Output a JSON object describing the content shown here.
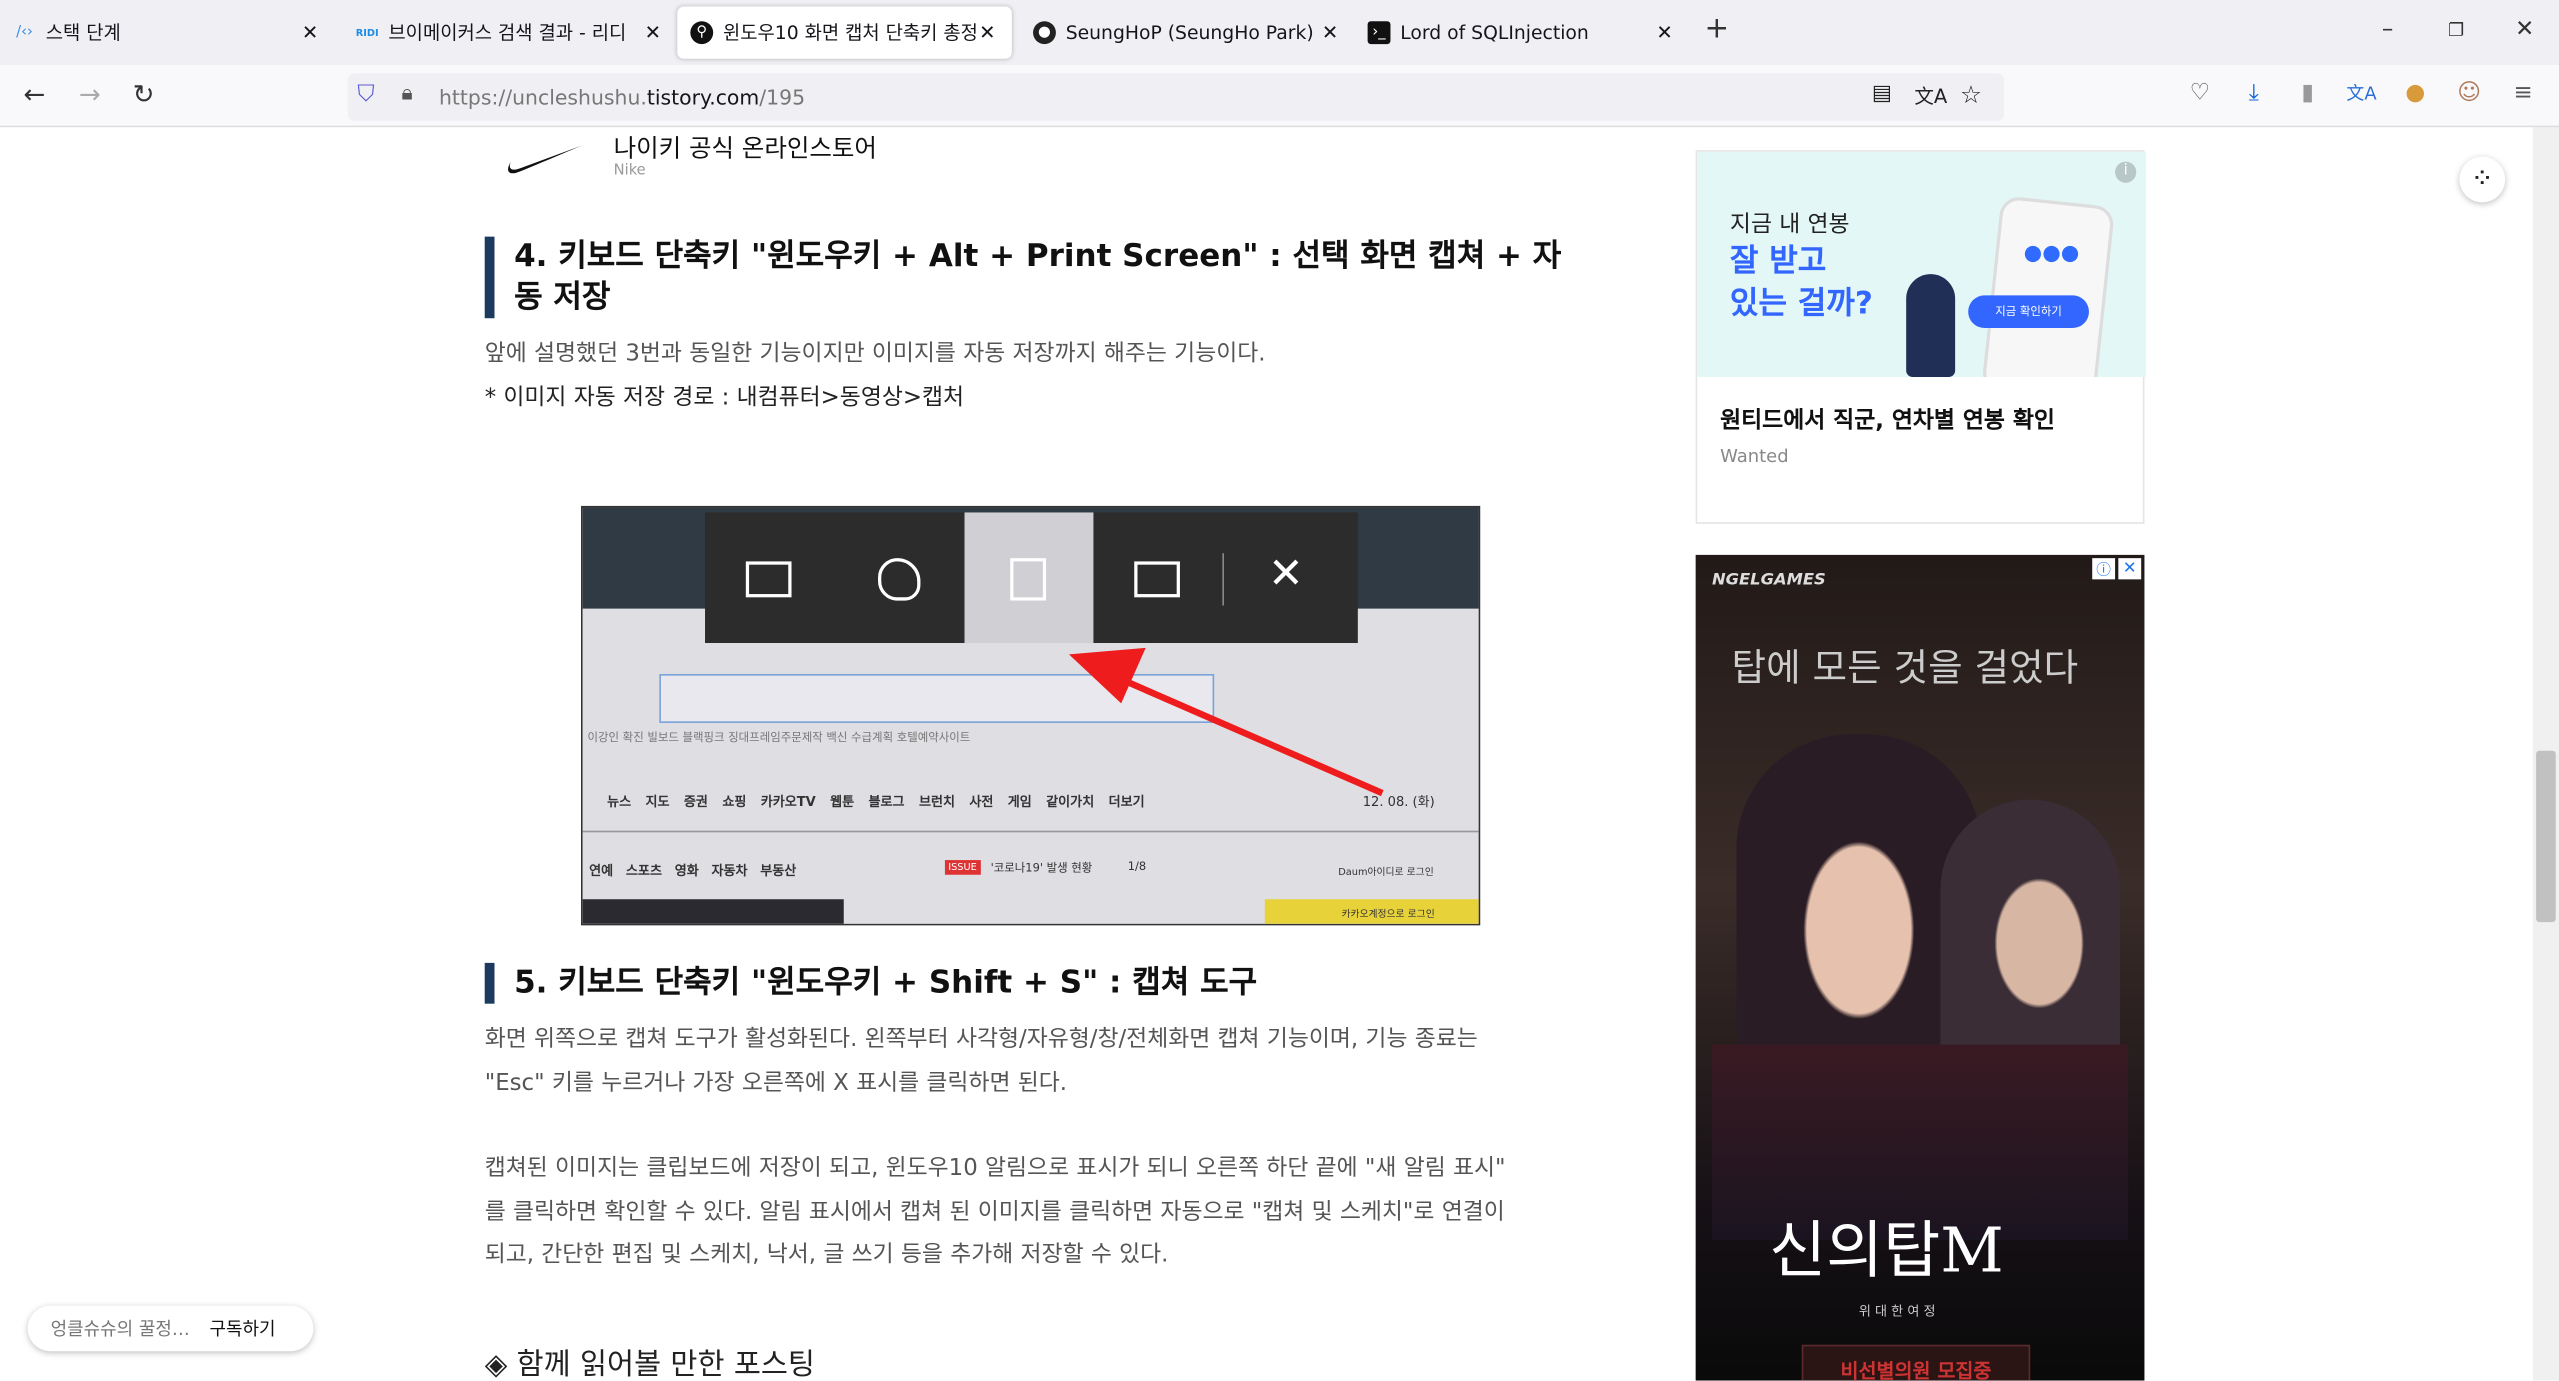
{
  "tabs": [
    {
      "title": "스택 단계",
      "icon": "code-brackets-icon",
      "active": false
    },
    {
      "title": "브이메이커스 검색 결과 - 리디",
      "icon": "ridi-icon",
      "active": false
    },
    {
      "title": "윈도우10 화면 캡처 단축키 총정리",
      "icon": "search-favicon",
      "active": true
    },
    {
      "title": "SeungHoP (SeungHo Park)",
      "icon": "github-icon",
      "active": false
    },
    {
      "title": "Lord of SQLInjection",
      "icon": "terminal-icon",
      "active": false
    }
  ],
  "url": {
    "prefix": "https://uncleshushu.",
    "domain": "tistory.com",
    "path": "/195"
  },
  "article": {
    "promo": {
      "title": "나이키 공식 온라인스토어",
      "brand": "Nike"
    },
    "h4": "4. 키보드 단축키 \"윈도우키 + Alt + Print Screen\" : 선택 화면 캡쳐 + 자동 저장",
    "p4a": "앞에 설명했던 3번과 동일한 기능이지만 이미지를 자동 저장까지 해주는 기능이다.",
    "p4b": "* 이미지 자동 저장 경로 : 내컴퓨터>동영상>캡처",
    "shot": {
      "menu": [
        "뉴스",
        "지도",
        "증권",
        "쇼핑",
        "카카오TV",
        "웹툰",
        "블로그",
        "브런치",
        "사전",
        "게임",
        "같이가치",
        "더보기"
      ],
      "date": "12. 08. (화)",
      "cats": [
        "연예",
        "스포츠",
        "영화",
        "자동차",
        "부동산"
      ],
      "issue": "ISSUE",
      "issue_text": "'코로나19' 발생 현황",
      "pager": "1/8",
      "login": "Daum아이디로 로그인",
      "kakao": "카카오계정으로 로그인",
      "trending": "이강인 확진   빌보드 블랙핑크   징대프레임주문제작   백신 수급계획   호텔예약사이트"
    },
    "h5": "5. 키보드 단축키 \"윈도우키 + Shift + S\" : 캡쳐 도구",
    "p5": [
      "화면 위쪽으로 캡쳐 도구가 활성화된다. 왼쪽부터 사각형/자유형/창/전체화면 캡쳐 기능이며, 기능 종료는",
      "\"Esc\" 키를 누르거나 가장 오른쪽에 X 표시를 클릭하면 된다."
    ],
    "p6": [
      "캡쳐된 이미지는 클립보드에 저장이 되고, 윈도우10 알림으로 표시가 되니 오른쪽 하단 끝에 \"새 알림 표시\"",
      "를 클릭하면 확인할 수 있다. 알림 표시에서 캡쳐 된 이미지를 클릭하면 자동으로 \"캡쳐 및 스케치\"로 연결이",
      "되고, 간단한 편집 및 스케치, 낙서, 글 쓰기 등을 추가해 저장할 수 있다."
    ],
    "related": "◈ 함께 읽어볼 만한 포스팅"
  },
  "ad1": {
    "line1": "지금 내 연봉",
    "line2": "잘 받고",
    "line3": "있는 걸까?",
    "cta": "지금 확인하기",
    "title": "원티드에서 직군, 연차별 연봉 확인",
    "brand": "Wanted"
  },
  "ad2": {
    "brand": "NGELGAMES",
    "tagline": "탑에 모든 것을 걸었다",
    "logo": "신의탑M",
    "sub": "위 대 한 여 정",
    "banner": "비선별의원 모집중"
  },
  "subscribe": {
    "blog": "엉클슈슈의 꿀정…",
    "button": "구독하기"
  },
  "colors": {
    "heading_bar": "#1b3a5e",
    "accent_blue": "#3366ff",
    "arrow": "#ee1c1c"
  }
}
